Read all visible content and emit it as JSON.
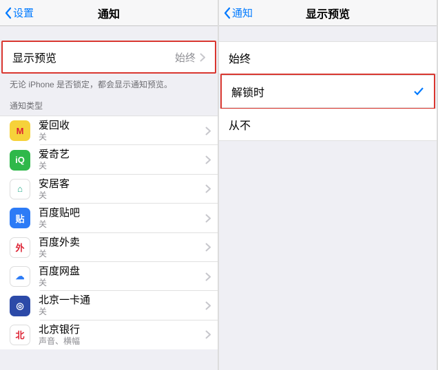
{
  "left": {
    "back_label": "设置",
    "title": "通知",
    "preview_row": {
      "label": "显示预览",
      "value": "始终"
    },
    "footnote": "无论 iPhone 是否锁定，都会显示通知预览。",
    "group_header": "通知类型",
    "apps": [
      {
        "name": "爱回收",
        "sub": "关",
        "bg": "#f6d23a",
        "fg": "#d23",
        "glyph": "M"
      },
      {
        "name": "爱奇艺",
        "sub": "关",
        "bg": "#2fb84a",
        "fg": "#fff",
        "glyph": "iQ"
      },
      {
        "name": "安居客",
        "sub": "关",
        "bg": "#ffffff",
        "fg": "#2a8",
        "glyph": "⌂",
        "border": true
      },
      {
        "name": "百度贴吧",
        "sub": "关",
        "bg": "#2c7bf6",
        "fg": "#fff",
        "glyph": "贴"
      },
      {
        "name": "百度外卖",
        "sub": "关",
        "bg": "#ffffff",
        "fg": "#d23",
        "glyph": "外",
        "border": true
      },
      {
        "name": "百度网盘",
        "sub": "关",
        "bg": "#ffffff",
        "fg": "#2c7bf6",
        "glyph": "☁",
        "border": true
      },
      {
        "name": "北京一卡通",
        "sub": "关",
        "bg": "#2c4aa8",
        "fg": "#fff",
        "glyph": "◎"
      },
      {
        "name": "北京银行",
        "sub": "声音、横幅",
        "bg": "#ffffff",
        "fg": "#d23",
        "glyph": "北",
        "border": true
      }
    ]
  },
  "right": {
    "back_label": "通知",
    "title": "显示预览",
    "options": [
      {
        "label": "始终",
        "selected": false
      },
      {
        "label": "解锁时",
        "selected": true
      },
      {
        "label": "从不",
        "selected": false
      }
    ]
  }
}
